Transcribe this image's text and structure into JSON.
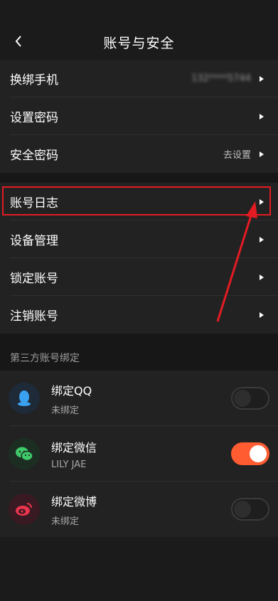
{
  "header": {
    "title": "账号与安全",
    "back_icon": "chevron-left-icon"
  },
  "group1": [
    {
      "label": "换绑手机",
      "value": "132****5744",
      "value_blurred": true
    },
    {
      "label": "设置密码",
      "value": ""
    },
    {
      "label": "安全密码",
      "value": "去设置"
    }
  ],
  "group2": [
    {
      "label": "账号日志"
    },
    {
      "label": "设备管理"
    },
    {
      "label": "锁定账号"
    },
    {
      "label": "注销账号"
    }
  ],
  "third_party": {
    "section_title": "第三方账号绑定",
    "items": [
      {
        "name": "绑定QQ",
        "status": "未绑定",
        "icon": "qq-icon",
        "bound": false
      },
      {
        "name": "绑定微信",
        "status": "LILY JAE",
        "icon": "wechat-icon",
        "bound": true
      },
      {
        "name": "绑定微博",
        "status": "未绑定",
        "icon": "weibo-icon",
        "bound": false
      }
    ]
  },
  "colors": {
    "accent": "#ff5c31",
    "highlight": "#e31b23",
    "background": "#1b1b1b",
    "row_bg": "#222222"
  }
}
